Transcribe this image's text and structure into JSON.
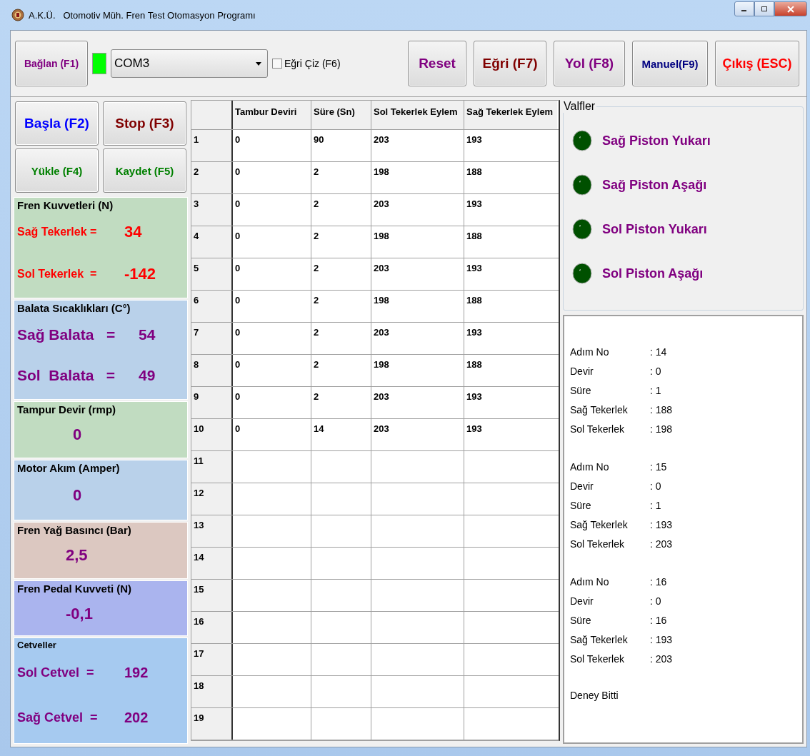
{
  "window": {
    "title": "A.K.Ü.   Otomotiv Müh. Fren Test Otomasyon Programı"
  },
  "toolbar": {
    "connect_button": {
      "label": "Bağlan (F1)",
      "color": "#800080"
    },
    "connection_led": {
      "connected": true
    },
    "port_select": {
      "value": "COM3"
    },
    "curve_checkbox": {
      "label": "Eğri Çiz (F6)",
      "checked": false
    },
    "buttons": [
      {
        "label": "Reset",
        "color": "#800080"
      },
      {
        "label": "Eğri (F7)",
        "color": "#800000"
      },
      {
        "label": "Yol (F8)",
        "color": "#800080"
      },
      {
        "label": "Manuel(F9)",
        "color": "#000080"
      },
      {
        "label": "Çıkış (ESC)",
        "color": "#ff0000"
      }
    ]
  },
  "control_buttons": [
    {
      "label": "Başla (F2)",
      "color": "#0000ff"
    },
    {
      "label": "Stop (F3)",
      "color": "#800000"
    },
    {
      "label": "Yükle (F4)",
      "color": "#008000"
    },
    {
      "label": "Kaydet (F5)",
      "color": "#008000"
    }
  ],
  "readouts": [
    {
      "title": "Fren Kuvvetleri (N)",
      "color": "#c1dcc1",
      "lines": [
        {
          "label": "Sağ Tekerlek =",
          "value": "34",
          "color": "#ff0000"
        },
        {
          "label": "Sol Tekerlek  =",
          "value": "-142",
          "color": "#ff0000"
        }
      ]
    },
    {
      "title": "Balata Sıcaklıkları (C°)",
      "color": "#b9d1ea",
      "lines": [
        {
          "label": "Sağ Balata   =",
          "value": "54",
          "color": "#800080"
        },
        {
          "label": "Sol  Balata   =",
          "value": "49",
          "color": "#800080"
        }
      ]
    },
    {
      "title": "Tampur Devir (rmp)",
      "color": "#c1dcc1",
      "value": "0"
    },
    {
      "title": "Motor Akım (Amper)",
      "color": "#b9d1ea",
      "value": "0"
    },
    {
      "title": "Fren Yağ Basıncı (Bar)",
      "color": "#dcc8c1",
      "value": "2,5"
    },
    {
      "title": "Fren Pedal Kuvveti (N)",
      "color": "#aab4ee",
      "value": "-0,1"
    },
    {
      "title": "Cetveller",
      "color": "#a6caf0",
      "lines": [
        {
          "label": "Sol Cetvel  =",
          "value": "192",
          "color": "#800080"
        },
        {
          "label": "Sağ Cetvel  =",
          "value": "202",
          "color": "#800080"
        }
      ]
    }
  ],
  "table": {
    "columns": [
      "Tambur Deviri",
      "Süre (Sn)",
      "Sol Tekerlek Eylem",
      "Sağ Tekerlek Eylem"
    ],
    "rows": [
      {
        "number": "1",
        "cells": [
          "0",
          "90",
          "203",
          "193"
        ]
      },
      {
        "number": "2",
        "cells": [
          "0",
          "2",
          "198",
          "188"
        ]
      },
      {
        "number": "3",
        "cells": [
          "0",
          "2",
          "203",
          "193"
        ]
      },
      {
        "number": "4",
        "cells": [
          "0",
          "2",
          "198",
          "188"
        ]
      },
      {
        "number": "5",
        "cells": [
          "0",
          "2",
          "203",
          "193"
        ]
      },
      {
        "number": "6",
        "cells": [
          "0",
          "2",
          "198",
          "188"
        ]
      },
      {
        "number": "7",
        "cells": [
          "0",
          "2",
          "203",
          "193"
        ]
      },
      {
        "number": "8",
        "cells": [
          "0",
          "2",
          "198",
          "188"
        ]
      },
      {
        "number": "9",
        "cells": [
          "0",
          "2",
          "203",
          "193"
        ]
      },
      {
        "number": "10",
        "cells": [
          "0",
          "14",
          "203",
          "193"
        ]
      },
      {
        "number": "11",
        "cells": []
      },
      {
        "number": "12",
        "cells": []
      },
      {
        "number": "13",
        "cells": []
      },
      {
        "number": "14",
        "cells": []
      },
      {
        "number": "15",
        "cells": []
      },
      {
        "number": "16",
        "cells": []
      },
      {
        "number": "17",
        "cells": []
      },
      {
        "number": "18",
        "cells": []
      },
      {
        "number": "19",
        "cells": []
      }
    ]
  },
  "valves": {
    "title": "Valfler",
    "items": [
      {
        "label": "Sağ Piston Yukarı",
        "on": false
      },
      {
        "label": "Sağ Piston Aşağı",
        "on": false
      },
      {
        "label": "Sol Piston Yukarı",
        "on": false
      },
      {
        "label": "Sol Piston Aşağı",
        "on": false
      }
    ]
  },
  "log": {
    "blocks": [
      {
        "lines": [
          {
            "label": "Adım No",
            "value": ": 14"
          },
          {
            "label": "Devir",
            "value": ": 0"
          },
          {
            "label": "Süre",
            "value": ": 1"
          },
          {
            "label": "Sağ Tekerlek",
            "value": ": 188"
          },
          {
            "label": "Sol Tekerlek",
            "value": ": 198"
          }
        ]
      },
      {
        "lines": [
          {
            "label": "Adım No",
            "value": ": 15"
          },
          {
            "label": "Devir",
            "value": ": 0"
          },
          {
            "label": "Süre",
            "value": ": 1"
          },
          {
            "label": "Sağ Tekerlek",
            "value": ": 193"
          },
          {
            "label": "Sol Tekerlek",
            "value": ": 203"
          }
        ]
      },
      {
        "lines": [
          {
            "label": "Adım No",
            "value": ": 16"
          },
          {
            "label": "Devir",
            "value": ": 0"
          },
          {
            "label": "Süre",
            "value": ": 16"
          },
          {
            "label": "Sağ Tekerlek",
            "value": ": 193"
          },
          {
            "label": "Sol Tekerlek",
            "value": ": 203"
          }
        ]
      }
    ],
    "footer": "Deney Bitti"
  }
}
